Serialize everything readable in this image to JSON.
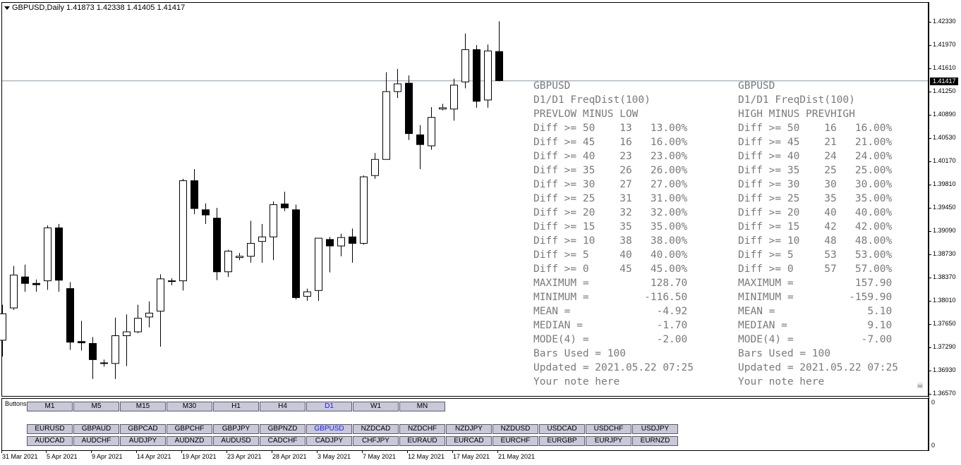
{
  "header": {
    "symbol_info": "GBPUSD,Daily  1.41873 1.42338 1.41405 1.41417"
  },
  "colors": {
    "bull_body": "#ffffff",
    "bear_body": "#000000",
    "text_gray": "#7a7a7a",
    "button_bg": "#c8c8d8",
    "active_button_text": "#1a1aff"
  },
  "price_axis": {
    "labels": [
      "1.42330",
      "1.41970",
      "1.41610",
      "1.41250",
      "1.40890",
      "1.40530",
      "1.40170",
      "1.39810",
      "1.39450",
      "1.39090",
      "1.38730",
      "1.38370",
      "1.38010",
      "1.37650",
      "1.37290",
      "1.36930",
      "1.36570"
    ],
    "current_price": "1.41417"
  },
  "date_axis": [
    "31 Mar 2021",
    "5 Apr 2021",
    "9 Apr 2021",
    "14 Apr 2021",
    "19 Apr 2021",
    "23 Apr 2021",
    "28 Apr 2021",
    "3 May 2021",
    "7 May 2021",
    "12 May 2021",
    "17 May 2021",
    "21 May 2021"
  ],
  "stats_left": {
    "lines": [
      "GBPUSD",
      "D1/D1 FreqDist(100)",
      "PREVLOW MINUS LOW",
      "Diff >= 50    13   13.00%",
      "Diff >= 45    16   16.00%",
      "Diff >= 40    23   23.00%",
      "Diff >= 35    26   26.00%",
      "Diff >= 30    27   27.00%",
      "Diff >= 25    31   31.00%",
      "Diff >= 20    32   32.00%",
      "Diff >= 15    35   35.00%",
      "Diff >= 10    38   38.00%",
      "Diff >= 5     40   40.00%",
      "Diff >= 0     45   45.00%",
      "MAXIMUM =          128.70",
      "MINIMUM =         -116.50",
      "MEAN =              -4.92",
      "MEDIAN =            -1.70",
      "MODE(4) =           -2.00",
      "Bars Used = 100",
      "Updated = 2021.05.22 07:25",
      "Your note here"
    ]
  },
  "stats_right": {
    "lines": [
      "GBPUSD",
      "D1/D1 FreqDist(100)",
      "HIGH MINUS PREVHIGH",
      "Diff >= 50    16   16.00%",
      "Diff >= 45    21   21.00%",
      "Diff >= 40    24   24.00%",
      "Diff >= 35    25   25.00%",
      "Diff >= 30    30   30.00%",
      "Diff >= 25    35   35.00%",
      "Diff >= 20    40   40.00%",
      "Diff >= 15    42   42.00%",
      "Diff >= 10    48   48.00%",
      "Diff >= 5     53   53.00%",
      "Diff >= 0     57   57.00%",
      "MAXIMUM =          157.90",
      "MINIMUM =         -159.90",
      "MEAN =               5.10",
      "MEDIAN =             9.10",
      "MODE(4) =           -7.00",
      "Bars Used = 100",
      "Updated = 2021.05.22 07:25",
      "Your note here"
    ]
  },
  "subwindow": {
    "label": "Buttons",
    "axis_top": "0",
    "axis_bottom": "0",
    "timeframes": [
      "M1",
      "M5",
      "M15",
      "M30",
      "H1",
      "H4",
      "D1",
      "W1",
      "MN"
    ],
    "active_timeframe": "D1",
    "symbols_row1": [
      "EURUSD",
      "GBPAUD",
      "GBPCAD",
      "GBPCHF",
      "GBPJPY",
      "GBPNZD",
      "GBPUSD",
      "NZDCAD",
      "NZDCHF",
      "NZDJPY",
      "NZDUSD",
      "USDCAD",
      "USDCHF",
      "USDJPY"
    ],
    "symbols_row2": [
      "AUDCAD",
      "AUDCHF",
      "AUDJPY",
      "AUDNZD",
      "AUDUSD",
      "CADCHF",
      "CADJPY",
      "CHFJPY",
      "EURAUD",
      "EURCAD",
      "EURCHF",
      "EURGBP",
      "EURJPY",
      "EURNZD"
    ],
    "active_symbol": "GBPUSD"
  },
  "chart_data": {
    "type": "candlestick",
    "symbol": "GBPUSD",
    "timeframe": "Daily",
    "y_range": [
      1.3657,
      1.4251
    ],
    "candles": [
      {
        "o": 1.374,
        "h": 1.3795,
        "l": 1.3715,
        "c": 1.3781
      },
      {
        "o": 1.379,
        "h": 1.3855,
        "l": 1.3787,
        "c": 1.3841
      },
      {
        "o": 1.3838,
        "h": 1.3857,
        "l": 1.3815,
        "c": 1.3828
      },
      {
        "o": 1.3828,
        "h": 1.3834,
        "l": 1.3815,
        "c": 1.3826
      },
      {
        "o": 1.3832,
        "h": 1.3918,
        "l": 1.3818,
        "c": 1.3914
      },
      {
        "o": 1.3914,
        "h": 1.392,
        "l": 1.3815,
        "c": 1.3833
      },
      {
        "o": 1.382,
        "h": 1.383,
        "l": 1.3725,
        "c": 1.3737
      },
      {
        "o": 1.3738,
        "h": 1.377,
        "l": 1.3724,
        "c": 1.3736
      },
      {
        "o": 1.3735,
        "h": 1.3745,
        "l": 1.368,
        "c": 1.371
      },
      {
        "o": 1.3705,
        "h": 1.371,
        "l": 1.3699,
        "c": 1.3705
      },
      {
        "o": 1.3704,
        "h": 1.3775,
        "l": 1.368,
        "c": 1.3747
      },
      {
        "o": 1.3747,
        "h": 1.378,
        "l": 1.37,
        "c": 1.3753
      },
      {
        "o": 1.3753,
        "h": 1.3795,
        "l": 1.3751,
        "c": 1.3774
      },
      {
        "o": 1.3776,
        "h": 1.38,
        "l": 1.376,
        "c": 1.3782
      },
      {
        "o": 1.3785,
        "h": 1.3842,
        "l": 1.373,
        "c": 1.3835
      },
      {
        "o": 1.3831,
        "h": 1.3836,
        "l": 1.3825,
        "c": 1.3832
      },
      {
        "o": 1.3832,
        "h": 1.399,
        "l": 1.3817,
        "c": 1.3987
      },
      {
        "o": 1.3987,
        "h": 1.4005,
        "l": 1.3935,
        "c": 1.3944
      },
      {
        "o": 1.3942,
        "h": 1.3952,
        "l": 1.392,
        "c": 1.3934
      },
      {
        "o": 1.3929,
        "h": 1.3945,
        "l": 1.3833,
        "c": 1.3846
      },
      {
        "o": 1.3846,
        "h": 1.388,
        "l": 1.3838,
        "c": 1.3878
      },
      {
        "o": 1.3868,
        "h": 1.3875,
        "l": 1.3864,
        "c": 1.387
      },
      {
        "o": 1.387,
        "h": 1.3925,
        "l": 1.386,
        "c": 1.389
      },
      {
        "o": 1.3893,
        "h": 1.392,
        "l": 1.386,
        "c": 1.39
      },
      {
        "o": 1.39,
        "h": 1.3955,
        "l": 1.3864,
        "c": 1.395
      },
      {
        "o": 1.3951,
        "h": 1.397,
        "l": 1.394,
        "c": 1.3945
      },
      {
        "o": 1.3942,
        "h": 1.395,
        "l": 1.3803,
        "c": 1.3806
      },
      {
        "o": 1.3808,
        "h": 1.382,
        "l": 1.3801,
        "c": 1.3815
      },
      {
        "o": 1.3817,
        "h": 1.3898,
        "l": 1.3801,
        "c": 1.3898
      },
      {
        "o": 1.3896,
        "h": 1.39,
        "l": 1.3845,
        "c": 1.3886
      },
      {
        "o": 1.3886,
        "h": 1.3905,
        "l": 1.387,
        "c": 1.3899
      },
      {
        "o": 1.39,
        "h": 1.3913,
        "l": 1.386,
        "c": 1.389
      },
      {
        "o": 1.389,
        "h": 1.3995,
        "l": 1.3888,
        "c": 1.3993
      },
      {
        "o": 1.3995,
        "h": 1.403,
        "l": 1.399,
        "c": 1.402
      },
      {
        "o": 1.402,
        "h": 1.4155,
        "l": 1.402,
        "c": 1.4125
      },
      {
        "o": 1.4125,
        "h": 1.416,
        "l": 1.4115,
        "c": 1.4137
      },
      {
        "o": 1.4138,
        "h": 1.415,
        "l": 1.405,
        "c": 1.406
      },
      {
        "o": 1.4058,
        "h": 1.4073,
        "l": 1.4005,
        "c": 1.4043
      },
      {
        "o": 1.4041,
        "h": 1.4101,
        "l": 1.4035,
        "c": 1.4085
      },
      {
        "o": 1.4098,
        "h": 1.4106,
        "l": 1.4096,
        "c": 1.41
      },
      {
        "o": 1.4098,
        "h": 1.4145,
        "l": 1.408,
        "c": 1.4135
      },
      {
        "o": 1.414,
        "h": 1.4215,
        "l": 1.413,
        "c": 1.419
      },
      {
        "o": 1.419,
        "h": 1.4197,
        "l": 1.41,
        "c": 1.411
      },
      {
        "o": 1.4112,
        "h": 1.4198,
        "l": 1.41,
        "c": 1.4188
      },
      {
        "o": 1.4187,
        "h": 1.4234,
        "l": 1.4141,
        "c": 1.4142
      }
    ]
  }
}
